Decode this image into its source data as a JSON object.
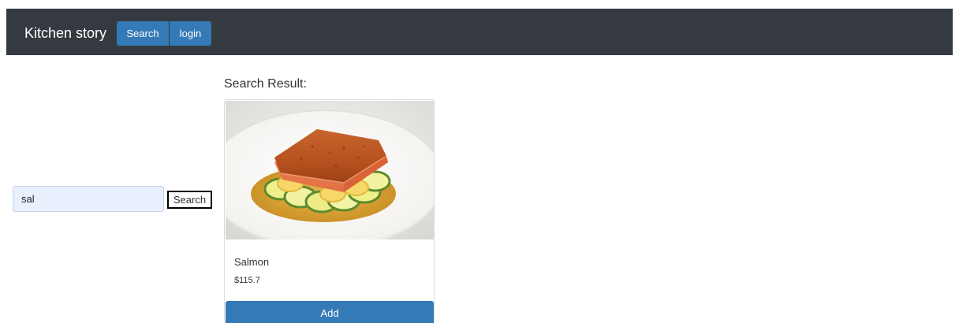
{
  "navbar": {
    "brand": "Kitchen story",
    "search_label": "Search",
    "login_label": "login"
  },
  "search": {
    "value": "sal",
    "button_label": "Search"
  },
  "results": {
    "heading": "Search Result:",
    "items": [
      {
        "name": "Salmon",
        "price": "$115.7",
        "add_label": "Add",
        "image": "salmon-dish-photo"
      }
    ]
  },
  "colors": {
    "navbar_bg": "#343a40",
    "primary": "#337ab7",
    "input_bg": "#e8f0fe"
  }
}
